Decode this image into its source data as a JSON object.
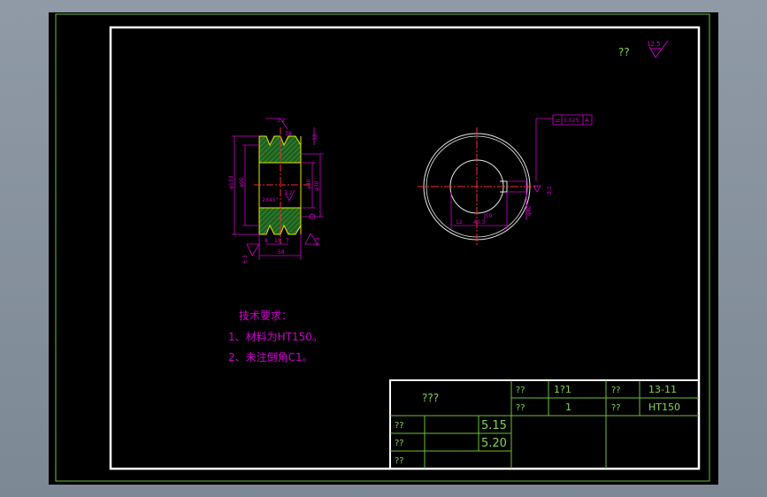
{
  "colors": {
    "background": "#000000",
    "border_green": "#6bbf3a",
    "frame_white": "#ffffff",
    "line_white": "#e8e8e8",
    "dim_magenta": "#d000d0",
    "text_green": "#86d44d",
    "center_red": "#ff2a2a",
    "hatch_green": "#2e7d2e",
    "part_yellow": "#e8e800"
  },
  "roughness": {
    "label": "??",
    "value": "12.5"
  },
  "tolerance_frame": {
    "symbol": "=",
    "value": "0.025",
    "datum": "A"
  },
  "pulley_section": {
    "dims": {
      "top_pitch": "3.2",
      "top_right": "32",
      "groove_angle": "38",
      "outer_dia": "φ133",
      "pitch_dia": "φ90",
      "bore_dia": "φ40",
      "right_dia": "φ30",
      "chamfer": "2X45°",
      "center_rough": "3.2",
      "bottom_width": "58",
      "bottom_a": "8",
      "bottom_b": "15",
      "bottom_c": "7",
      "left_rough": "6.3",
      "right_rough": "6.3"
    }
  },
  "pulley_front": {
    "dims": {
      "keyway_width": "12",
      "keyway_depth": "43.3",
      "keyway_rough": "3.2",
      "keyway_tol": "JS9",
      "bore_label": "φ40"
    }
  },
  "notes": {
    "heading": "技术要求：",
    "line1": "1、材料为HT150。",
    "line2": "2、未注倒角C1。"
  },
  "title_block": {
    "part_name": "???",
    "r1_label_a": "??",
    "r1_value_a": "1?1",
    "r1_label_b": "??",
    "r1_value_b": "13-11",
    "r2_label_a": "??",
    "r2_value_a": "1",
    "r2_label_b": "??",
    "r2_value_b": "HT150",
    "r3_label": "??",
    "r3_value": "5.15",
    "r4_label": "??",
    "r4_value": "5.20",
    "r5_label": "??"
  }
}
